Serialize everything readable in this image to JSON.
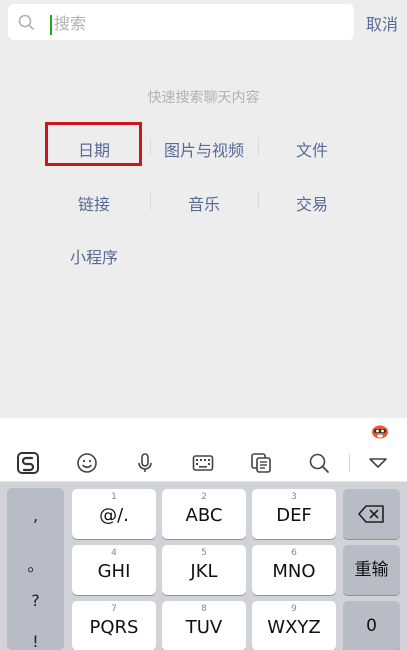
{
  "search": {
    "placeholder": "搜索",
    "cancel_label": "取消"
  },
  "hint": "快速搜索聊天内容",
  "categories": [
    {
      "label": "日期"
    },
    {
      "label": "图片与视频"
    },
    {
      "label": "文件"
    },
    {
      "label": "链接"
    },
    {
      "label": "音乐"
    },
    {
      "label": "交易"
    },
    {
      "label": "小程序"
    }
  ],
  "toolbar": {
    "icons": [
      "sogou-logo-icon",
      "emoji-icon",
      "microphone-icon",
      "keyboard-icon",
      "clipboard-icon",
      "search-icon",
      "collapse-icon"
    ]
  },
  "keyboard": {
    "punctuation": [
      ",",
      "。",
      "?",
      "!"
    ],
    "keys": [
      {
        "num": "1",
        "label": "@/."
      },
      {
        "num": "2",
        "label": "ABC"
      },
      {
        "num": "3",
        "label": "DEF"
      },
      {
        "num": "4",
        "label": "GHI"
      },
      {
        "num": "5",
        "label": "JKL"
      },
      {
        "num": "6",
        "label": "MNO"
      },
      {
        "num": "7",
        "label": "PQRS"
      },
      {
        "num": "8",
        "label": "TUV"
      },
      {
        "num": "9",
        "label": "WXYZ"
      }
    ],
    "retype_label": "重输",
    "zero_label": "0"
  },
  "colors": {
    "link": "#576b95",
    "highlight_border": "#c9171e",
    "caret": "#1aad19"
  }
}
